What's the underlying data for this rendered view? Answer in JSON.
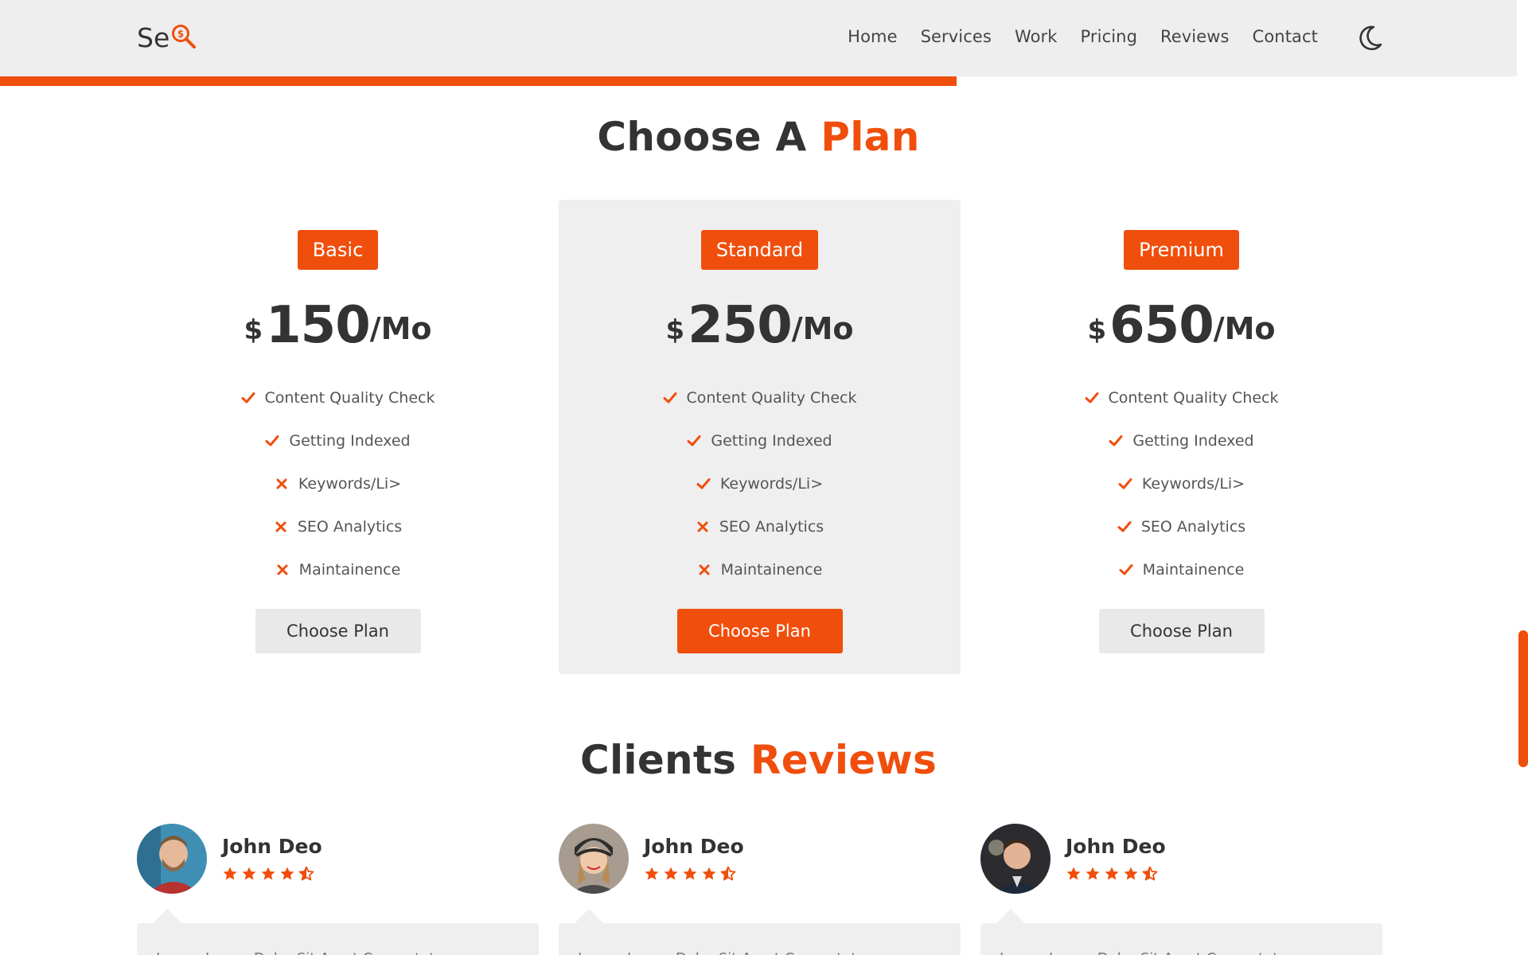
{
  "header": {
    "logo_text": "Se",
    "logo_icon": "magnifier-dollar-icon",
    "nav": [
      "Home",
      "Services",
      "Work",
      "Pricing",
      "Reviews",
      "Contact"
    ],
    "theme_icon": "moon-icon"
  },
  "progress": {
    "scroll_fraction": 0.626
  },
  "colors": {
    "accent": "#f04e0c",
    "card_bg": "#efefef",
    "header_bg": "#eeeeee",
    "text": "#333333"
  },
  "plans_section": {
    "title_main": "Choose A",
    "title_accent": "Plan"
  },
  "plans": [
    {
      "name": "Basic",
      "currency": "$",
      "amount": "150",
      "period": "/Mo",
      "features": [
        {
          "label": "Content Quality Check",
          "included": true
        },
        {
          "label": "Getting Indexed",
          "included": true
        },
        {
          "label": "Keywords/Li>",
          "included": false
        },
        {
          "label": "SEO Analytics",
          "included": false
        },
        {
          "label": "Maintainence",
          "included": false
        }
      ],
      "button": "Choose Plan",
      "featured": false
    },
    {
      "name": "Standard",
      "currency": "$",
      "amount": "250",
      "period": "/Mo",
      "features": [
        {
          "label": "Content Quality Check",
          "included": true
        },
        {
          "label": "Getting Indexed",
          "included": true
        },
        {
          "label": "Keywords/Li>",
          "included": true
        },
        {
          "label": "SEO Analytics",
          "included": false
        },
        {
          "label": "Maintainence",
          "included": false
        }
      ],
      "button": "Choose Plan",
      "featured": true
    },
    {
      "name": "Premium",
      "currency": "$",
      "amount": "650",
      "period": "/Mo",
      "features": [
        {
          "label": "Content Quality Check",
          "included": true
        },
        {
          "label": "Getting Indexed",
          "included": true
        },
        {
          "label": "Keywords/Li>",
          "included": true
        },
        {
          "label": "SEO Analytics",
          "included": true
        },
        {
          "label": "Maintainence",
          "included": true
        }
      ],
      "button": "Choose Plan",
      "featured": false
    }
  ],
  "reviews_section": {
    "title_main": "Clients",
    "title_accent": "Reviews"
  },
  "reviews": [
    {
      "name": "John Deo",
      "rating": 4.5,
      "text": "Lorem Ipsum Dolor Sit Amet Consectetur"
    },
    {
      "name": "John Deo",
      "rating": 4.5,
      "text": "Lorem Ipsum Dolor Sit Amet Consectetur"
    },
    {
      "name": "John Deo",
      "rating": 4.5,
      "text": "Lorem Ipsum Dolor Sit Amet Consectetur"
    }
  ]
}
